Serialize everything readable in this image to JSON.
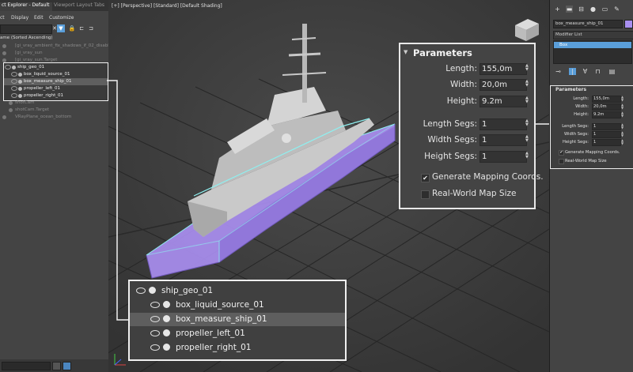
{
  "scene_explorer": {
    "tabs": [
      "ct Explorer - Default",
      "Viewport Layout Tabs"
    ],
    "menu": [
      "ct",
      "Display",
      "Edit",
      "Customize"
    ],
    "header": "ame (Sorted Ascending)",
    "items_above": [
      "[gi_vray_ambient_fix_shadows_if_02_disabled",
      "[gi_vray_sun",
      "[gi_vray_sun.Target"
    ],
    "items_callout": [
      "ship_geo_01",
      "box_liquid_source_01",
      "box_measure_ship_01",
      "propeller_left_01",
      "propeller_right_01"
    ],
    "items_below": [
      "shotCam",
      "shotCam.Target",
      "VRayPlane_ocean_bottom"
    ]
  },
  "viewport": {
    "label": "[+] [Perspective] [Standard] [Default Shading]"
  },
  "parameters": {
    "title": "Parameters",
    "length_label": "Length:",
    "length": "155,0m",
    "width_label": "Width:",
    "width": "20,0m",
    "height_label": "Height:",
    "height": "9.2m",
    "length_segs_label": "Length Segs:",
    "length_segs": "1",
    "width_segs_label": "Width Segs:",
    "width_segs": "1",
    "height_segs_label": "Height Segs:",
    "height_segs": "1",
    "gen_mapping_label": "Generate Mapping Coords.",
    "gen_mapping_checked": true,
    "real_world_label": "Real-World Map Size",
    "real_world_checked": false
  },
  "tree_callout": {
    "items": [
      "ship_geo_01",
      "box_liquid_source_01",
      "box_measure_ship_01",
      "propeller_left_01",
      "propeller_right_01"
    ]
  },
  "command_panel": {
    "object_name": "box_measure_ship_01",
    "object_color": "#a88ff0",
    "modifier_list": "Modifier List",
    "modifier_stack_item": "Box"
  },
  "colors": {
    "accent": "#5a9ed9",
    "box_fill": "#a98ef0",
    "box_edge": "#8ef0f0"
  }
}
